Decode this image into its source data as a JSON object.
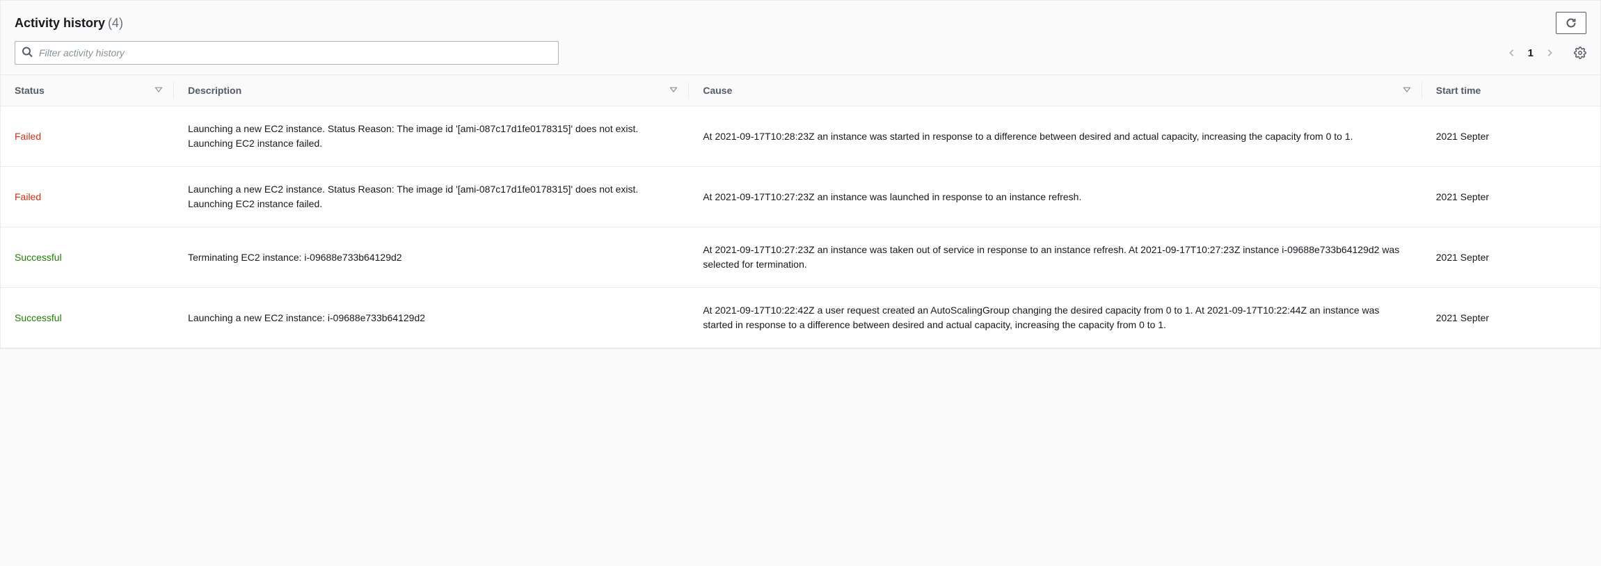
{
  "header": {
    "title": "Activity history",
    "count_label": "(4)"
  },
  "search": {
    "placeholder": "Filter activity history"
  },
  "pager": {
    "page": "1"
  },
  "columns": {
    "status": "Status",
    "description": "Description",
    "cause": "Cause",
    "start_time": "Start time"
  },
  "statuses": {
    "failed": "Failed",
    "successful": "Successful"
  },
  "rows": [
    {
      "status": "failed",
      "description": "Launching a new EC2 instance. Status Reason: The image id '[ami-087c17d1fe0178315]' does not exist. Launching EC2 instance failed.",
      "cause": "At 2021-09-17T10:28:23Z an instance was started in response to a difference between desired and actual capacity, increasing the capacity from 0 to 1.",
      "start_time": "2021 Septer"
    },
    {
      "status": "failed",
      "description": "Launching a new EC2 instance. Status Reason: The image id '[ami-087c17d1fe0178315]' does not exist. Launching EC2 instance failed.",
      "cause": "At 2021-09-17T10:27:23Z an instance was launched in response to an instance refresh.",
      "start_time": "2021 Septer"
    },
    {
      "status": "successful",
      "description": "Terminating EC2 instance: i-09688e733b64129d2",
      "cause": "At 2021-09-17T10:27:23Z an instance was taken out of service in response to an instance refresh. At 2021-09-17T10:27:23Z instance i-09688e733b64129d2 was selected for termination.",
      "start_time": "2021 Septer"
    },
    {
      "status": "successful",
      "description": "Launching a new EC2 instance: i-09688e733b64129d2",
      "cause": "At 2021-09-17T10:22:42Z a user request created an AutoScalingGroup changing the desired capacity from 0 to 1. At 2021-09-17T10:22:44Z an instance was started in response to a difference between desired and actual capacity, increasing the capacity from 0 to 1.",
      "start_time": "2021 Septer"
    }
  ]
}
